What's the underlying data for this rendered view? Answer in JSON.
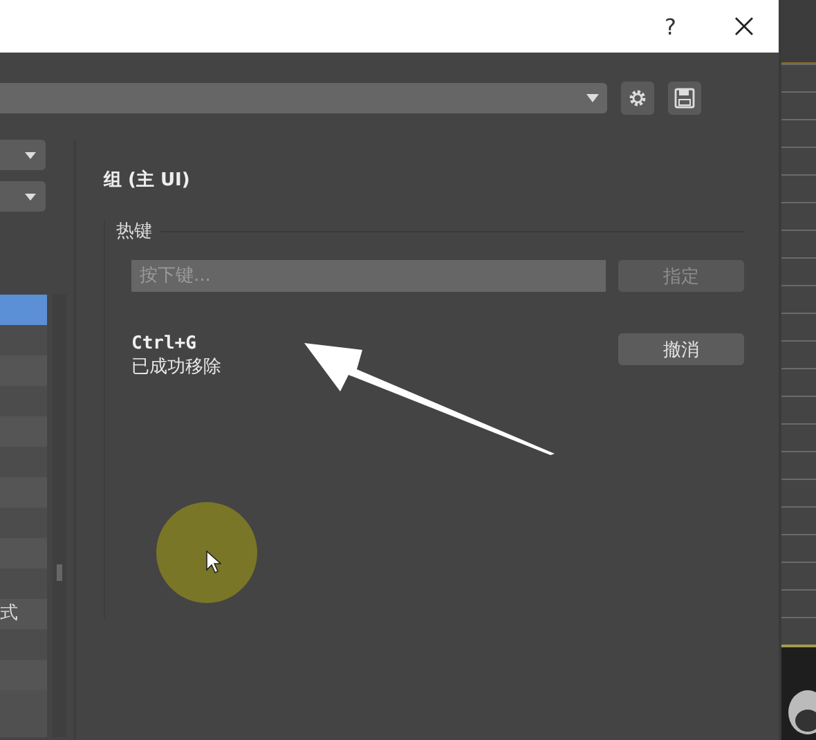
{
  "window": {
    "help": "?"
  },
  "sidebar": {
    "dropdowns": [
      {
        "kind": "dropdown"
      },
      {
        "kind": "dropdown"
      }
    ],
    "items": [
      {
        "selected": true
      },
      {
        "selected": false
      },
      {
        "selected": false
      },
      {
        "selected": false
      },
      {
        "selected": false
      },
      {
        "selected": false
      },
      {
        "selected": false
      },
      {
        "selected": false
      },
      {
        "selected": false
      },
      {
        "selected": false
      },
      {
        "label": "式",
        "selected": false
      },
      {
        "selected": false
      },
      {
        "selected": false
      }
    ]
  },
  "panel": {
    "title": "组 (主 UI)",
    "group": "热键",
    "placeholder": "按下键...",
    "assign_button": {
      "label": "指定",
      "disabled": true
    },
    "shortcut": "Ctrl+G",
    "status": "已成功移除",
    "undo_button": {
      "label": "撤消",
      "disabled": false
    }
  }
}
